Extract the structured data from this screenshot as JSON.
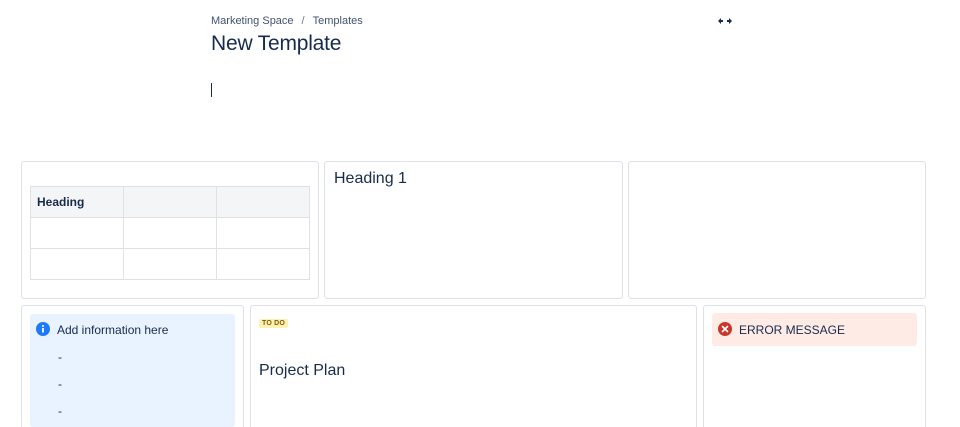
{
  "breadcrumb": {
    "space": "Marketing Space",
    "separator": "/",
    "section": "Templates"
  },
  "toolbar": {
    "expand_icon": "expand-width-icon"
  },
  "page": {
    "title": "New Template"
  },
  "table": {
    "header": [
      "Heading",
      "",
      ""
    ],
    "rows": [
      [
        "",
        "",
        ""
      ],
      [
        "",
        "",
        ""
      ]
    ]
  },
  "heading_card": {
    "text": "Heading 1"
  },
  "info_panel": {
    "icon": "info-icon",
    "text": "Add information here",
    "bullets": [
      "-",
      "-",
      "-"
    ],
    "color": "#e9f2ff"
  },
  "plan_card": {
    "status": "TO DO",
    "status_color": "#fff0b3",
    "title": "Project Plan"
  },
  "error_panel": {
    "icon": "error-icon",
    "text": "ERROR MESSAGE",
    "color": "#ffebe6"
  }
}
